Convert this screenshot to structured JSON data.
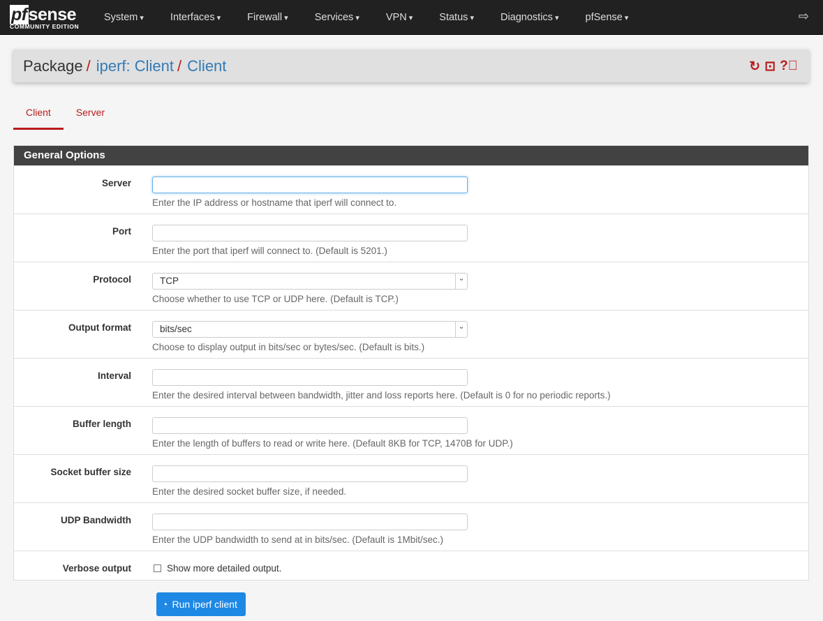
{
  "nav": {
    "logo_main": "pfsense",
    "logo_sub": "COMMUNITY EDITION",
    "items": [
      "System",
      "Interfaces",
      "Firewall",
      "Services",
      "VPN",
      "Status",
      "Diagnostics",
      "pfSense"
    ]
  },
  "breadcrumb": {
    "root": "Package",
    "mid": "iperf: Client",
    "current": "Client"
  },
  "tabs": [
    "Client",
    "Server"
  ],
  "panel_title": "General Options",
  "fields": [
    {
      "label": "Server",
      "value": "",
      "help": "Enter the IP address or hostname that iperf will connect to."
    },
    {
      "label": "Port",
      "value": "",
      "help": "Enter the port that iperf will connect to. (Default is 5201.)"
    },
    {
      "label": "Protocol",
      "value": "TCP",
      "help": "Choose whether to use TCP or UDP here. (Default is TCP.)"
    },
    {
      "label": "Output format",
      "value": "bits/sec",
      "help": "Choose to display output in bits/sec or bytes/sec. (Default is bits.)"
    },
    {
      "label": "Interval",
      "value": "",
      "help": "Enter the desired interval between bandwidth, jitter and loss reports here. (Default is 0 for no periodic reports.)"
    },
    {
      "label": "Buffer length",
      "value": "",
      "help": "Enter the length of buffers to read or write here. (Default 8KB for TCP, 1470B for UDP.)"
    },
    {
      "label": "Socket buffer size",
      "value": "",
      "help": "Enter the desired socket buffer size, if needed."
    },
    {
      "label": "UDP Bandwidth",
      "value": "",
      "help": "Enter the UDP bandwidth to send at in bits/sec. (Default is 1Mbit/sec.)"
    }
  ],
  "verbose": {
    "label": "Verbose output",
    "text": "Show more detailed output.",
    "checked": false
  },
  "run_button": "Run iperf client"
}
